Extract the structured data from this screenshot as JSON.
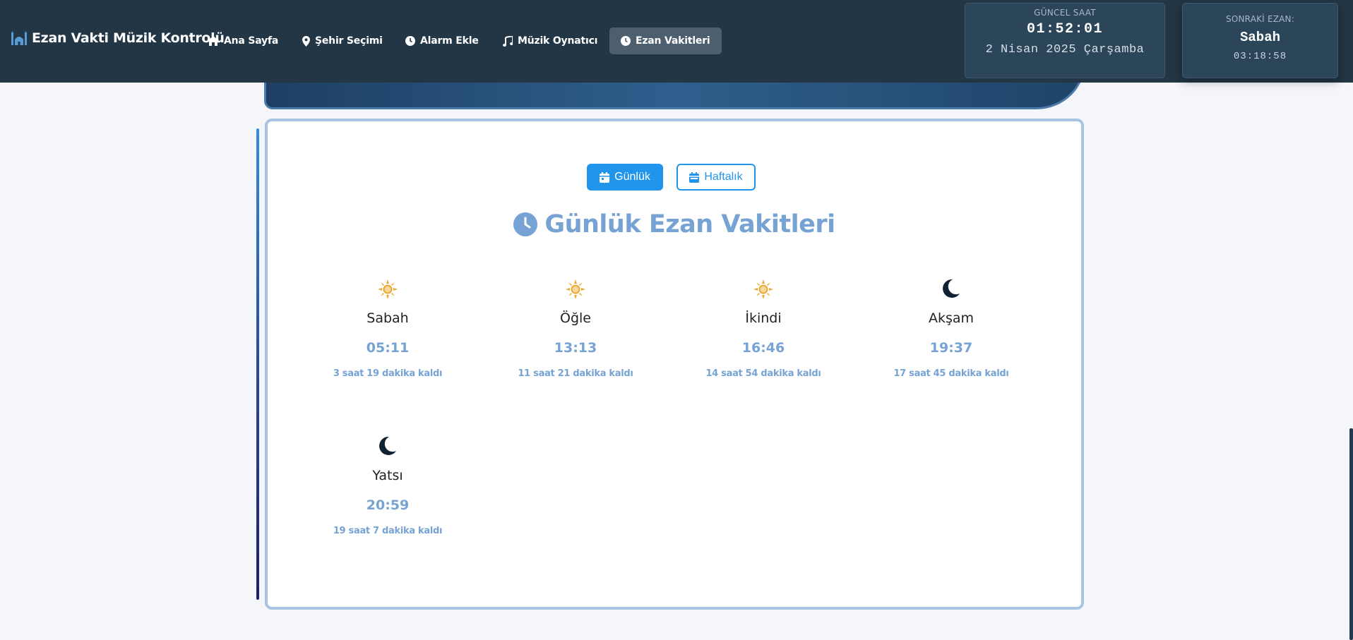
{
  "nav": {
    "brand": "Ezan Vakti Müzik Kontrolü",
    "items": [
      {
        "label": "Ana Sayfa",
        "icon": "home-icon"
      },
      {
        "label": "Şehir Seçimi",
        "icon": "map-pin-icon"
      },
      {
        "label": "Alarm Ekle",
        "icon": "clock-icon"
      },
      {
        "label": "Müzik Oynatıcı",
        "icon": "music-icon"
      },
      {
        "label": "Ezan Vakitleri",
        "icon": "clock-icon",
        "active": true
      }
    ]
  },
  "clock": {
    "label": "GÜNCEL SAAT",
    "time": "01:52:01",
    "date": "2 Nisan 2025 Çarşamba"
  },
  "next_prayer": {
    "label": "SONRAKİ EZAN:",
    "name": "Sabah",
    "remaining": "03:18:58"
  },
  "view_toggle": {
    "daily": "Günlük",
    "weekly": "Haftalık"
  },
  "section": {
    "title": "Günlük Ezan Vakitleri"
  },
  "prayers": [
    {
      "name": "Sabah",
      "time": "05:11",
      "left": "3 saat 19 dakika kaldı",
      "icon": "sun-icon"
    },
    {
      "name": "Öğle",
      "time": "13:13",
      "left": "11 saat 21 dakika kaldı",
      "icon": "sun-icon"
    },
    {
      "name": "İkindi",
      "time": "16:46",
      "left": "14 saat 54 dakika kaldı",
      "icon": "sun-icon"
    },
    {
      "name": "Akşam",
      "time": "19:37",
      "left": "17 saat 45 dakika kaldı",
      "icon": "moon-icon"
    },
    {
      "name": "Yatsı",
      "time": "20:59",
      "left": "19 saat 7 dakika kaldı",
      "icon": "moon-icon"
    }
  ],
  "colors": {
    "navbar": "#233645",
    "accent": "#2195eb",
    "title": "#76a3d3",
    "sun": "#e8a935",
    "moon": "#0f2233"
  }
}
